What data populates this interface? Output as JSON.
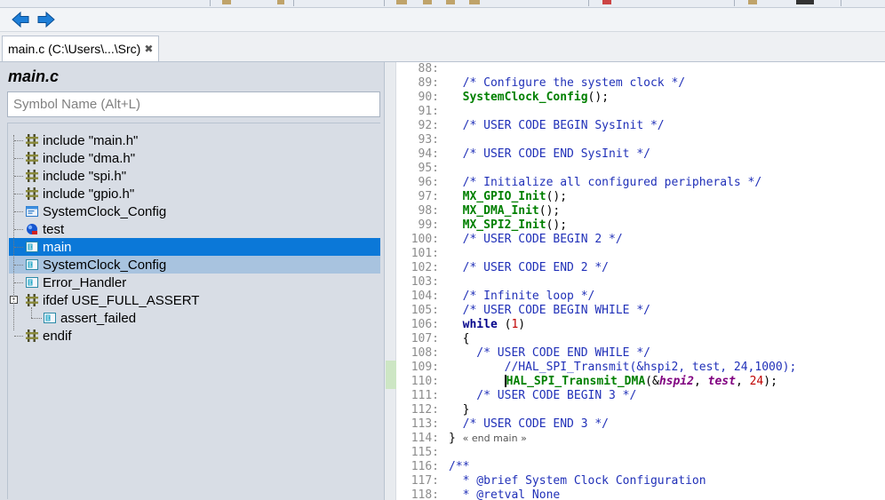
{
  "tab": {
    "label": "main.c (C:\\Users\\...\\Src)",
    "close": "✖"
  },
  "outline": {
    "title": "main.c",
    "search_placeholder": "Symbol Name (Alt+L)",
    "items": [
      {
        "label": "include \"main.h\"",
        "icon": "include-icon",
        "level": 0
      },
      {
        "label": "include \"dma.h\"",
        "icon": "include-icon",
        "level": 0
      },
      {
        "label": "include \"spi.h\"",
        "icon": "include-icon",
        "level": 0
      },
      {
        "label": "include \"gpio.h\"",
        "icon": "include-icon",
        "level": 0
      },
      {
        "label": "SystemClock_Config",
        "icon": "function-prototype-icon",
        "level": 0
      },
      {
        "label": "test",
        "icon": "variable-icon",
        "level": 0
      },
      {
        "label": "main",
        "icon": "function-icon",
        "level": 0,
        "selected": true
      },
      {
        "label": "SystemClock_Config",
        "icon": "function-icon",
        "level": 0,
        "highlight": true
      },
      {
        "label": "Error_Handler",
        "icon": "function-icon",
        "level": 0
      },
      {
        "label": "ifdef USE_FULL_ASSERT",
        "icon": "include-icon",
        "level": 0,
        "expander": "-"
      },
      {
        "label": "assert_failed",
        "icon": "function-icon",
        "level": 1
      },
      {
        "label": "endif",
        "icon": "include-icon",
        "level": 0
      }
    ]
  },
  "editor": {
    "lines": [
      {
        "n": "88:",
        "segs": []
      },
      {
        "n": "89:",
        "segs": [
          [
            "com",
            "  /* Configure the system clock */"
          ]
        ]
      },
      {
        "n": "90:",
        "segs": [
          [
            "p",
            "  "
          ],
          [
            "fn",
            "SystemClock_Config"
          ],
          [
            "p",
            "();"
          ]
        ]
      },
      {
        "n": "91:",
        "segs": []
      },
      {
        "n": "92:",
        "segs": [
          [
            "com",
            "  /* USER CODE BEGIN SysInit */"
          ]
        ]
      },
      {
        "n": "93:",
        "segs": []
      },
      {
        "n": "94:",
        "segs": [
          [
            "com",
            "  /* USER CODE END SysInit */"
          ]
        ]
      },
      {
        "n": "95:",
        "segs": []
      },
      {
        "n": "96:",
        "segs": [
          [
            "com",
            "  /* Initialize all configured peripherals */"
          ]
        ]
      },
      {
        "n": "97:",
        "segs": [
          [
            "p",
            "  "
          ],
          [
            "fn",
            "MX_GPIO_Init"
          ],
          [
            "p",
            "();"
          ]
        ]
      },
      {
        "n": "98:",
        "segs": [
          [
            "p",
            "  "
          ],
          [
            "fn",
            "MX_DMA_Init"
          ],
          [
            "p",
            "();"
          ]
        ]
      },
      {
        "n": "99:",
        "segs": [
          [
            "p",
            "  "
          ],
          [
            "fn",
            "MX_SPI2_Init"
          ],
          [
            "p",
            "();"
          ]
        ]
      },
      {
        "n": "100:",
        "segs": [
          [
            "com",
            "  /* USER CODE BEGIN 2 */"
          ]
        ]
      },
      {
        "n": "101:",
        "segs": []
      },
      {
        "n": "102:",
        "segs": [
          [
            "com",
            "  /* USER CODE END 2 */"
          ]
        ]
      },
      {
        "n": "103:",
        "segs": []
      },
      {
        "n": "104:",
        "segs": [
          [
            "com",
            "  /* Infinite loop */"
          ]
        ]
      },
      {
        "n": "105:",
        "segs": [
          [
            "com",
            "  /* USER CODE BEGIN WHILE */"
          ]
        ]
      },
      {
        "n": "106:",
        "segs": [
          [
            "p",
            "  "
          ],
          [
            "kw",
            "while"
          ],
          [
            "p",
            " ("
          ],
          [
            "num",
            "1"
          ],
          [
            "p",
            ")"
          ]
        ]
      },
      {
        "n": "107:",
        "segs": [
          [
            "p",
            "  {"
          ]
        ]
      },
      {
        "n": "108:",
        "segs": [
          [
            "com",
            "    /* USER CODE END WHILE */"
          ]
        ]
      },
      {
        "n": "109:",
        "segs": [
          [
            "com",
            "        //HAL_SPI_Transmit(&hspi2, test, 24,1000);"
          ]
        ]
      },
      {
        "n": "110:",
        "segs": [
          [
            "p",
            "        "
          ],
          [
            "caret",
            ""
          ],
          [
            "fn",
            "HAL_SPI_Transmit_DMA"
          ],
          [
            "p",
            "(&"
          ],
          [
            "var",
            "hspi2"
          ],
          [
            "p",
            ", "
          ],
          [
            "var",
            "test"
          ],
          [
            "p",
            ", "
          ],
          [
            "num",
            "24"
          ],
          [
            "p",
            ");"
          ]
        ]
      },
      {
        "n": "111:",
        "segs": [
          [
            "com",
            "    /* USER CODE BEGIN 3 */"
          ]
        ]
      },
      {
        "n": "112:",
        "segs": [
          [
            "p",
            "  }"
          ]
        ]
      },
      {
        "n": "113:",
        "segs": [
          [
            "com",
            "  /* USER CODE END 3 */"
          ]
        ]
      },
      {
        "n": "114:",
        "segs": [
          [
            "p",
            "} "
          ],
          [
            "fold",
            "« end main »"
          ]
        ]
      },
      {
        "n": "115:",
        "segs": []
      },
      {
        "n": "116:",
        "segs": [
          [
            "com",
            "/**"
          ]
        ]
      },
      {
        "n": "117:",
        "segs": [
          [
            "com",
            "  * @brief System Clock Configuration"
          ]
        ]
      },
      {
        "n": "118:",
        "segs": [
          [
            "com",
            "  * @retval None"
          ]
        ]
      }
    ]
  },
  "colors": {
    "selection": "#0b78d8",
    "highlight": "#a8c3df",
    "panel": "#d8dde5",
    "comment": "#2030b8",
    "function": "#008000"
  }
}
